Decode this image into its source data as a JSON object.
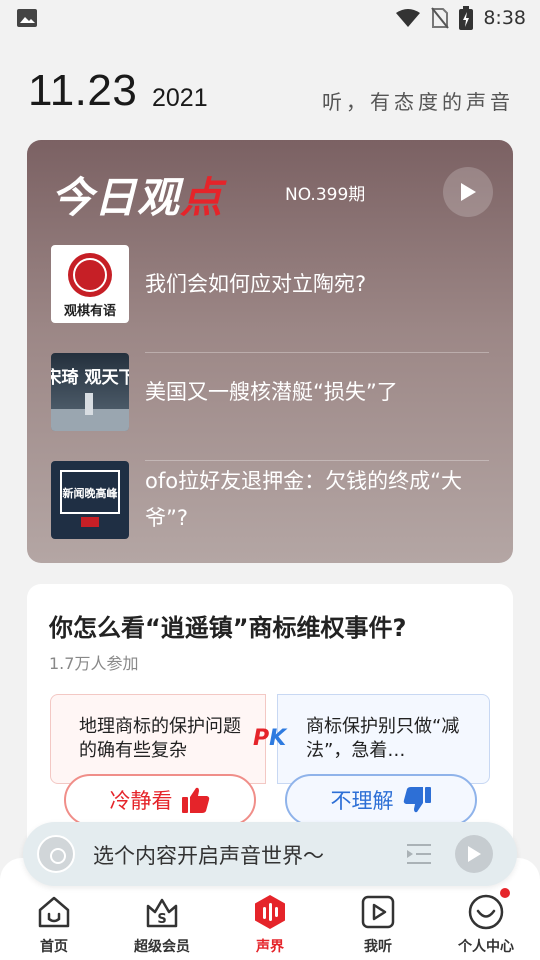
{
  "status_bar": {
    "time": "8:38",
    "icons": [
      "image-icon",
      "wifi-icon",
      "no-sim-icon",
      "battery-charging-icon"
    ]
  },
  "header": {
    "date": "11.23",
    "year": "2021",
    "slogan": "听，有态度的声音"
  },
  "today_card": {
    "title_main": "今日观",
    "title_dot": "点",
    "issue": "NO.399期",
    "items": [
      {
        "title": "我们会如何应对立陶宛?",
        "thumb_text": "观棋有语"
      },
      {
        "title": "美国又一艘核潜艇“损失”了",
        "thumb_text": "宋琦 观天下"
      },
      {
        "title": "ofo拉好友退押金：欠钱的终成“大爷”?",
        "thumb_text": "新闻晚高峰"
      }
    ]
  },
  "poll": {
    "question": "你怎么看“逍遥镇”商标维权事件?",
    "participants": "1.7万人参加",
    "option_left": "地理商标的保护问题的确有些复杂",
    "option_right": "商标保护别只做“减法”，急着…",
    "pk_p": "P",
    "pk_k": "K",
    "vote_left": "冷静看",
    "vote_right": "不理解"
  },
  "player": {
    "prompt": "选个内容开启声音世界～"
  },
  "tabs": [
    {
      "label": "首页",
      "icon": "home-icon"
    },
    {
      "label": "超级会员",
      "icon": "vip-icon"
    },
    {
      "label": "声界",
      "icon": "sound-world-icon",
      "active": true
    },
    {
      "label": "我听",
      "icon": "my-listen-icon"
    },
    {
      "label": "个人中心",
      "icon": "profile-icon"
    }
  ],
  "colors": {
    "accent": "#e5242a",
    "blue": "#2d6fd6"
  }
}
